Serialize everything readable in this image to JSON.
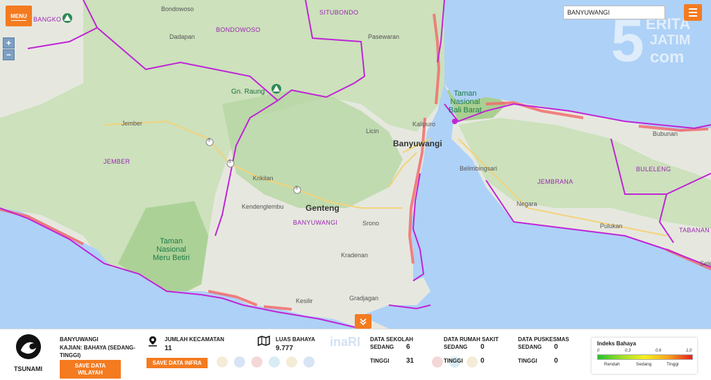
{
  "menu": {
    "label": "MENU"
  },
  "zoom": {
    "in": "+",
    "out": "−"
  },
  "search": {
    "value": "BANYUWANGI"
  },
  "watermark": {
    "line1": "ERITA",
    "line2": "JATIM",
    "line3": "com"
  },
  "map": {
    "cities": [
      {
        "name": "Bondowoso"
      },
      {
        "name": "Dadapan"
      },
      {
        "name": "Pasewaran"
      },
      {
        "name": "Jember"
      },
      {
        "name": "Licin"
      },
      {
        "name": "Kalipuro"
      },
      {
        "name": "Krikilan"
      },
      {
        "name": "Kendenglembu"
      },
      {
        "name": "Srono"
      },
      {
        "name": "Kradenan"
      },
      {
        "name": "Kesilir"
      },
      {
        "name": "Gradjagan"
      },
      {
        "name": "Belimbingsari"
      },
      {
        "name": "Negara"
      },
      {
        "name": "Pulukan"
      },
      {
        "name": "Bubunan"
      },
      {
        "name": "Sele"
      }
    ],
    "big_cities": [
      {
        "name": "Banyuwangi"
      },
      {
        "name": "Genteng"
      }
    ],
    "regions": [
      {
        "name": "SITUBONDO"
      },
      {
        "name": "BONDOWOSO"
      },
      {
        "name": "JEMBER"
      },
      {
        "name": "BANYUWANGI"
      },
      {
        "name": "JEMBRANA"
      },
      {
        "name": "BULELENG"
      },
      {
        "name": "TABANAN"
      }
    ],
    "parks": [
      {
        "name": "Taman\nNasional\nBali Barat"
      },
      {
        "name": "Taman\nNasional\nMeru Betiri"
      }
    ],
    "mountain": {
      "name": "Gn. Raung"
    },
    "partial_label": "BANGKO",
    "route_numbers": [
      "3",
      "3",
      "3"
    ]
  },
  "panel": {
    "hazard_type": "TSUNAMI",
    "region_name": "BANYUWANGI",
    "study": "KAJIAN: BAHAYA (SEDANG-TINGGI)",
    "save_region": "SAVE DATA WILAYAH",
    "kecamatan_label": "JUMLAH KECAMATAN",
    "kecamatan_value": "11",
    "save_infra": "SAVE DATA INFRA",
    "luas_label": "LUAS BAHAYA",
    "luas_value": "9.777",
    "sekolah": {
      "label": "DATA SEKOLAH",
      "sedang_label": "SEDANG",
      "sedang": "6",
      "tinggi_label": "TINGGI",
      "tinggi": "31"
    },
    "rs": {
      "label": "DATA RUMAH SAKIT",
      "sedang_label": "SEDANG",
      "sedang": "0",
      "tinggi_label": "TINGGI",
      "tinggi": "0"
    },
    "puskesmas": {
      "label": "DATA PUSKESMAS",
      "sedang_label": "SEDANG",
      "sedang": "0",
      "tinggi_label": "TINGGI",
      "tinggi": "0"
    },
    "legend": {
      "title": "Indeks Bahaya",
      "ticks": [
        "0",
        "0,3",
        "0,6",
        "1,0"
      ],
      "classes": [
        "Rendah",
        "Sedang",
        "Tinggi"
      ]
    },
    "logos_text": "inaRI"
  },
  "colors": {
    "accent": "#f47b20",
    "boundary": "#c024d6",
    "sea": "#aed1f7",
    "land": "#e6e8df",
    "forest": "#c6dfb5",
    "hazard": "#f26d6d"
  }
}
